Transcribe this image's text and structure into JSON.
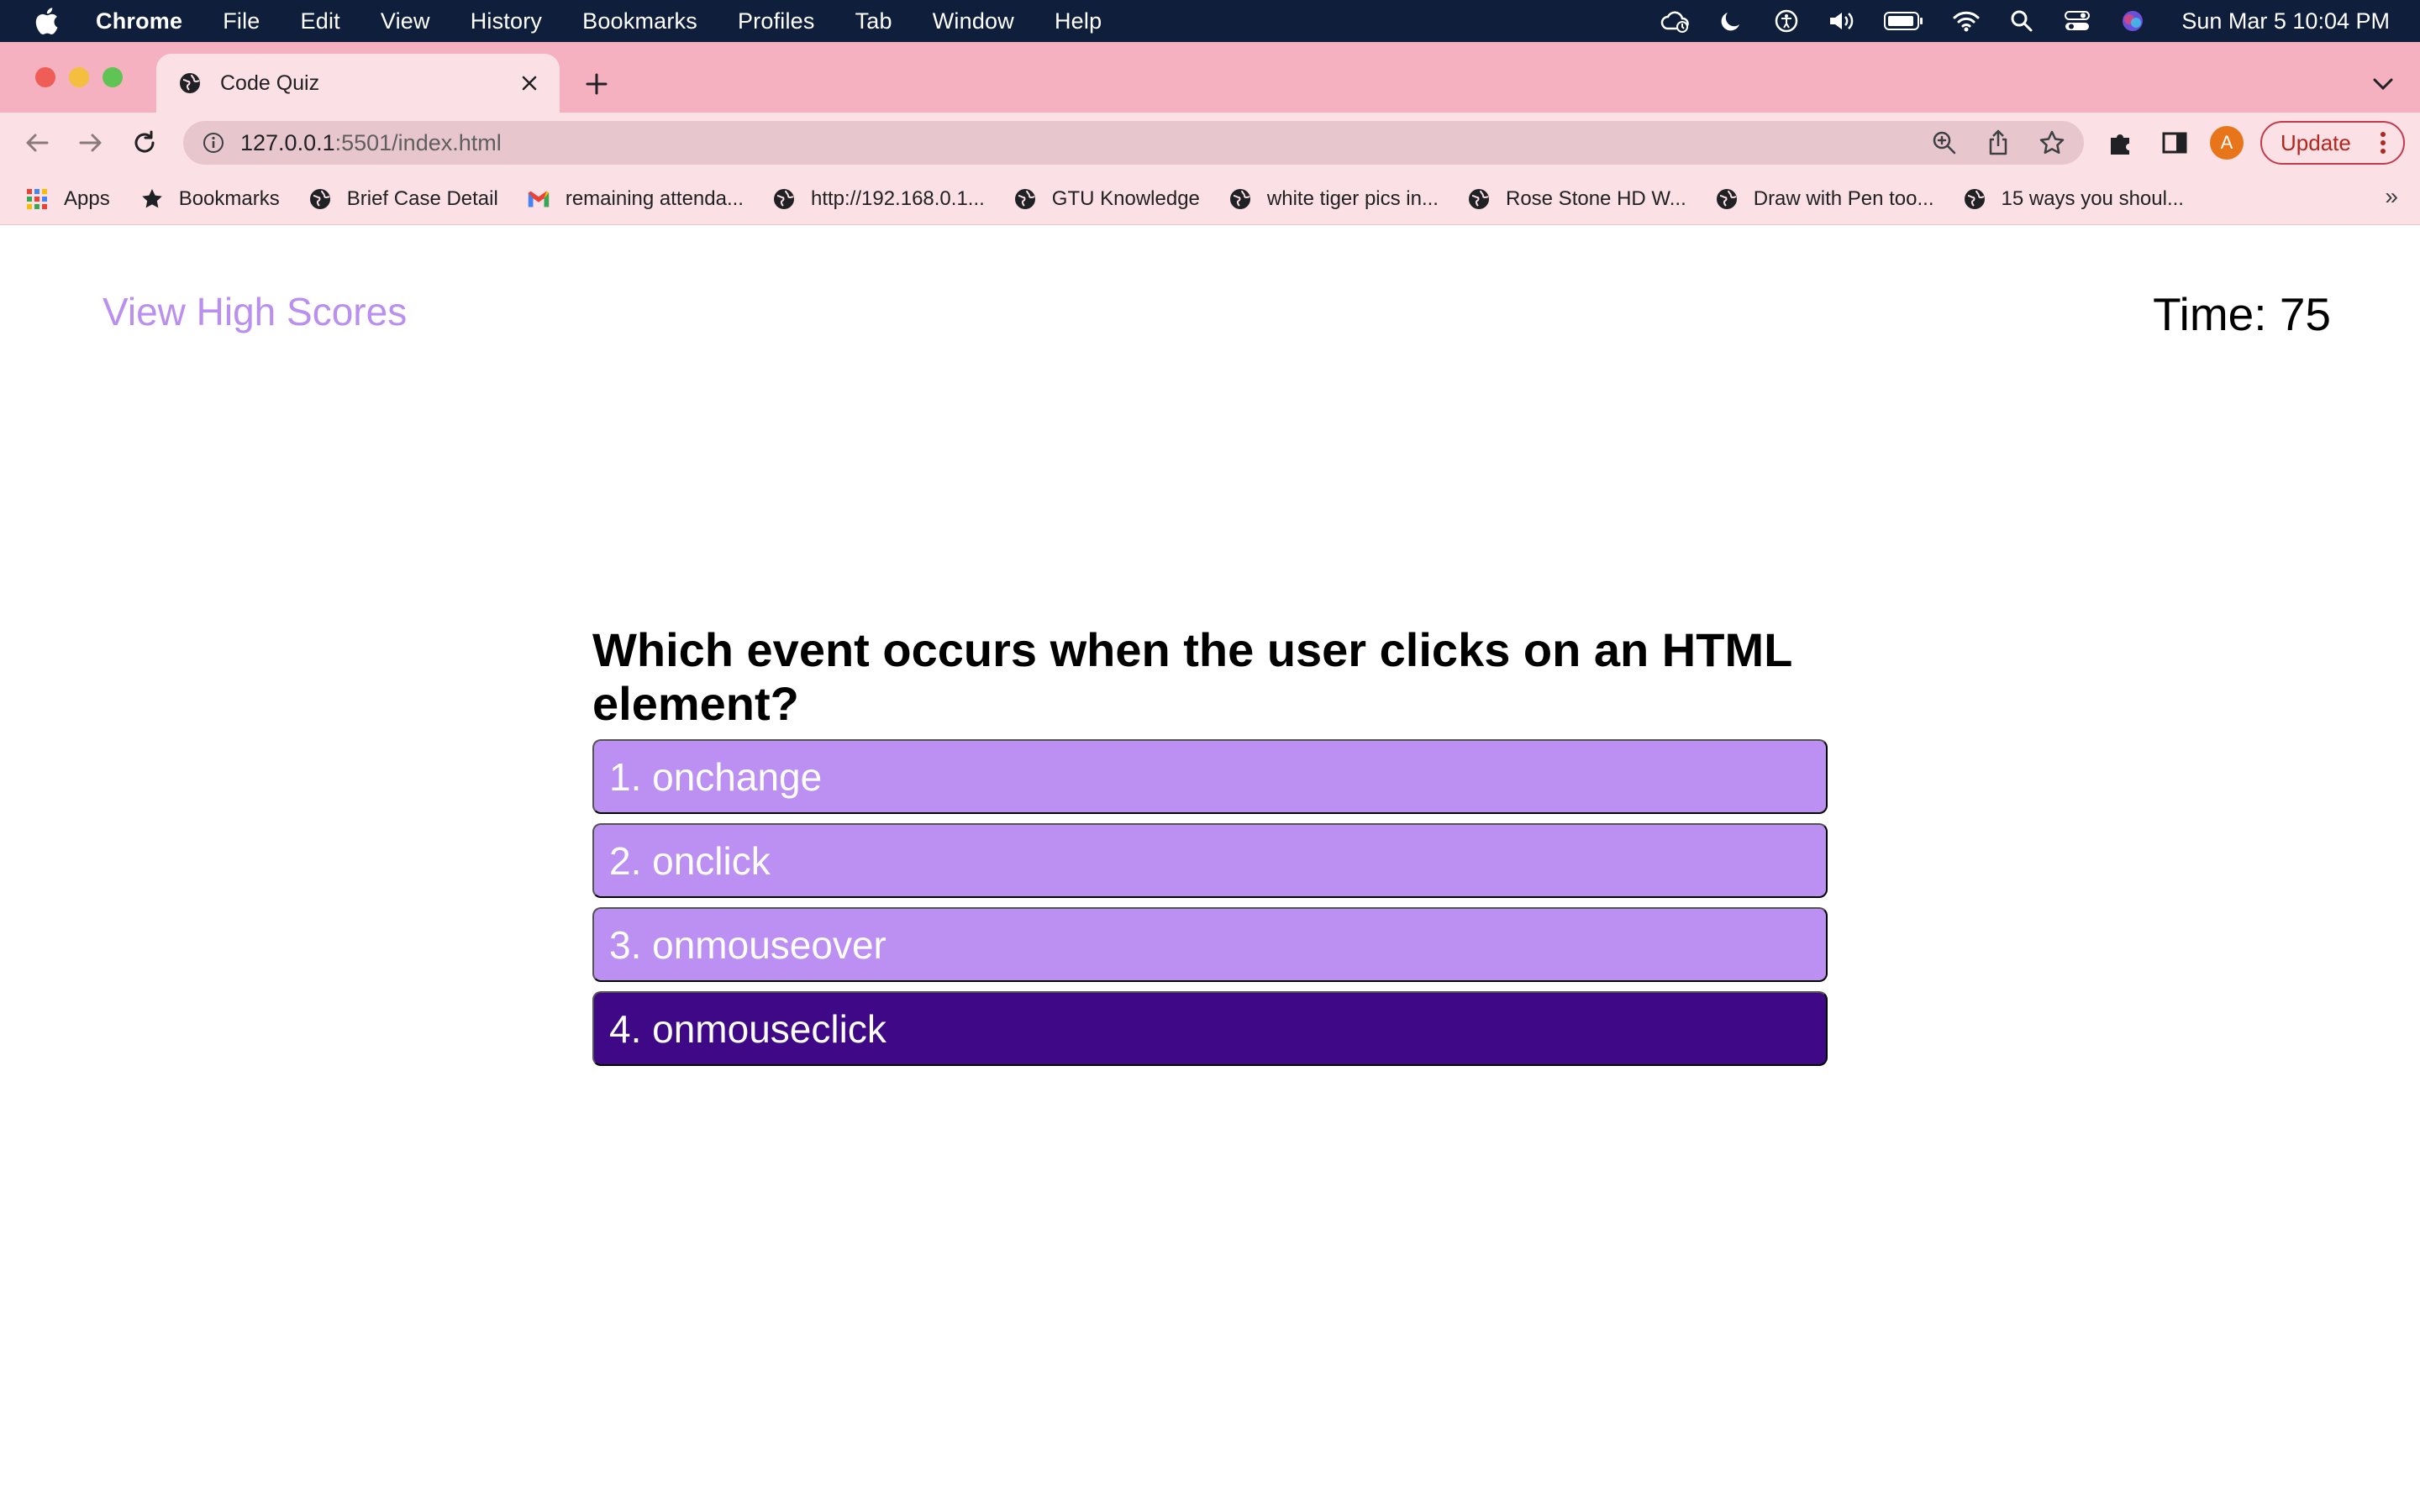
{
  "menubar": {
    "app_name": "Chrome",
    "items": [
      "File",
      "Edit",
      "View",
      "History",
      "Bookmarks",
      "Profiles",
      "Tab",
      "Window",
      "Help"
    ],
    "clock": "Sun Mar 5  10:04 PM"
  },
  "browser": {
    "tab_title": "Code Quiz",
    "url_host": "127.0.0.1",
    "url_path": ":5501/index.html",
    "update_label": "Update",
    "avatar_letter": "A",
    "bookmarks": [
      {
        "label": "Apps",
        "icon": "apps-grid-icon"
      },
      {
        "label": "Bookmarks",
        "icon": "star-icon"
      },
      {
        "label": "Brief Case Detail",
        "icon": "globe-icon"
      },
      {
        "label": "remaining attenda...",
        "icon": "gmail-icon"
      },
      {
        "label": "http://192.168.0.1...",
        "icon": "globe-icon"
      },
      {
        "label": "GTU Knowledge",
        "icon": "globe-icon"
      },
      {
        "label": "white tiger pics in...",
        "icon": "globe-icon"
      },
      {
        "label": "Rose Stone HD W...",
        "icon": "globe-icon"
      },
      {
        "label": "Draw with Pen too...",
        "icon": "globe-icon"
      },
      {
        "label": "15 ways you shoul...",
        "icon": "globe-icon"
      }
    ],
    "bookmarks_more": "»"
  },
  "quiz": {
    "high_scores_link": "View High Scores",
    "timer": "Time: 75",
    "question": "Which event occurs when the user clicks on an HTML element?",
    "answers": [
      "1. onchange",
      "2. onclick",
      "3. onmouseover",
      "4. onmouseclick"
    ],
    "selected_answer_index": 3
  },
  "colors": {
    "accent_light": "#bb90f2",
    "accent_dark": "#3f0886",
    "link": "#b98ff0",
    "tab_strip": "#f5b1bf",
    "toolbar": "#fbe0e5"
  }
}
